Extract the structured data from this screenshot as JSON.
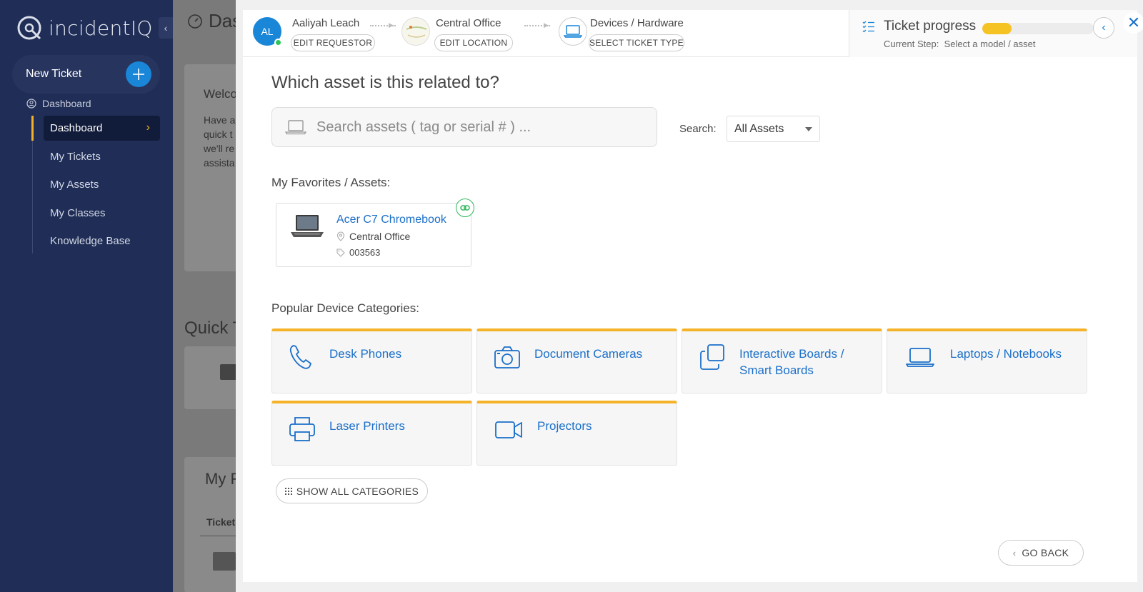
{
  "sidebar": {
    "logo_text": "incidentIQ",
    "new_ticket_label": "New Ticket",
    "section_label": "Dashboard",
    "items": [
      {
        "label": "Dashboard"
      },
      {
        "label": "My Tickets"
      },
      {
        "label": "My Assets"
      },
      {
        "label": "My Classes"
      },
      {
        "label": "Knowledge Base"
      }
    ],
    "accent": "#f1b22a",
    "bg": "#1f2d57"
  },
  "background": {
    "title": "Das",
    "welcome": "Welco",
    "welcome_text": [
      "Have a",
      "quick t",
      "we'll re",
      "assista"
    ],
    "quick": "Quick T",
    "my": "My F",
    "ticket": "Ticket"
  },
  "stepper": {
    "requestor": {
      "initials": "AL",
      "name": "Aaliyah Leach",
      "button": "EDIT REQUESTOR"
    },
    "location": {
      "name": "Central Office",
      "button": "EDIT LOCATION"
    },
    "type": {
      "name": "Devices / Hardware",
      "button": "SELECT TICKET TYPE"
    }
  },
  "progress": {
    "title": "Ticket progress",
    "current_step_label": "Current Step:",
    "current_step_value": "Select a model / asset",
    "fraction": 0.26,
    "color": "#f5c324"
  },
  "main": {
    "question": "Which asset is this related to?",
    "search_placeholder": "Search assets ( tag or serial # ) ...",
    "search_label": "Search:",
    "search_scope": "All Assets",
    "favorites_label": "My Favorites / Assets:",
    "favorite": {
      "name": "Acer C7 Chromebook",
      "location": "Central Office",
      "tag": "003563"
    },
    "popular_label": "Popular Device Categories:",
    "categories": [
      {
        "label": "Desk Phones",
        "icon": "phone-icon"
      },
      {
        "label": "Document Cameras",
        "icon": "camera-icon"
      },
      {
        "label": "Interactive Boards / Smart Boards",
        "icon": "copy-icon"
      },
      {
        "label": "Laptops / Notebooks",
        "icon": "laptop-icon"
      },
      {
        "label": "Laser Printers",
        "icon": "printer-icon"
      },
      {
        "label": "Projectors",
        "icon": "video-camera-icon"
      }
    ],
    "show_all_label": "SHOW ALL CATEGORIES",
    "go_back_label": "GO BACK"
  },
  "colors": {
    "link": "#1a6fc9",
    "primary": "#1a86d8",
    "category_accent": "#f5b32a"
  }
}
